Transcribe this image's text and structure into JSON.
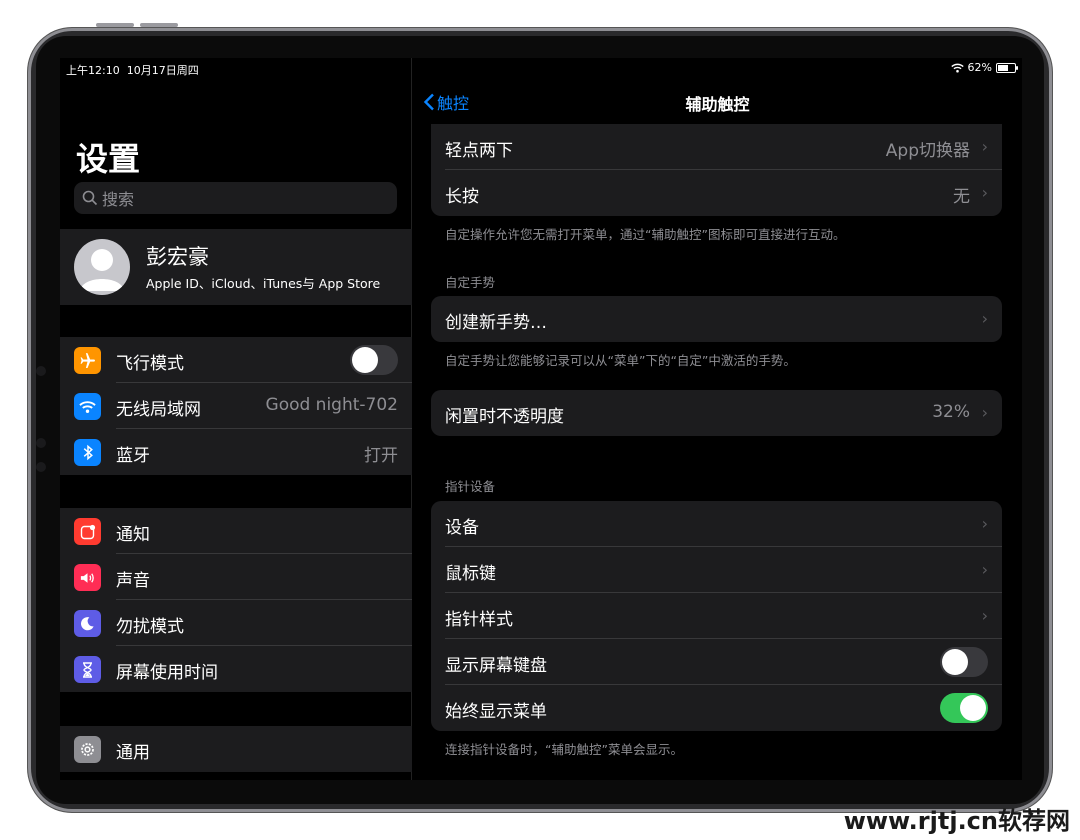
{
  "status": {
    "time": "上午12:10",
    "date": "10月17日周四",
    "battery": "62%",
    "battery_level": 0.62
  },
  "sidebar": {
    "title": "设置",
    "search_placeholder": "搜索",
    "profile": {
      "name": "彭宏豪",
      "subtitle": "Apple ID、iCloud、iTunes与 App Store"
    },
    "group1": [
      {
        "label": "飞行模式",
        "icon": "airplane-icon",
        "color": "#ff9500",
        "toggle": false
      },
      {
        "label": "无线局域网",
        "icon": "wifi-icon",
        "color": "#0a84ff",
        "value": "Good night-702"
      },
      {
        "label": "蓝牙",
        "icon": "bluetooth-icon",
        "color": "#0a84ff",
        "value": "打开"
      }
    ],
    "group2": [
      {
        "label": "通知",
        "icon": "notification-icon",
        "color": "#ff3b30"
      },
      {
        "label": "声音",
        "icon": "sound-icon",
        "color": "#ff2d55"
      },
      {
        "label": "勿扰模式",
        "icon": "moon-icon",
        "color": "#5e5ce6"
      },
      {
        "label": "屏幕使用时间",
        "icon": "hourglass-icon",
        "color": "#5e5ce6"
      }
    ],
    "group3": [
      {
        "label": "通用",
        "icon": "gear-icon",
        "color": "#8e8e93"
      }
    ]
  },
  "detail": {
    "back_label": "触控",
    "title": "辅助触控",
    "actions": [
      {
        "label": "轻点两下",
        "value": "App切换器"
      },
      {
        "label": "长按",
        "value": "无"
      }
    ],
    "actions_note": "自定操作允许您无需打开菜单，通过“辅助触控”图标即可直接进行互动。",
    "gestures_header": "自定手势",
    "create_gesture": "创建新手势…",
    "gestures_note": "自定手势让您能够记录可以从“菜单”下的“自定”中激活的手势。",
    "idle_opacity": {
      "label": "闲置时不透明度",
      "value": "32%"
    },
    "pointer_header": "指针设备",
    "pointer_rows": [
      {
        "label": "设备"
      },
      {
        "label": "鼠标键"
      },
      {
        "label": "指针样式"
      }
    ],
    "show_keyboard": {
      "label": "显示屏幕键盘",
      "on": false
    },
    "always_menu": {
      "label": "始终显示菜单",
      "on": true
    },
    "pointer_note": "连接指针设备时，“辅助触控”菜单会显示。"
  },
  "watermark": "www.rjtj.cn软荐网"
}
